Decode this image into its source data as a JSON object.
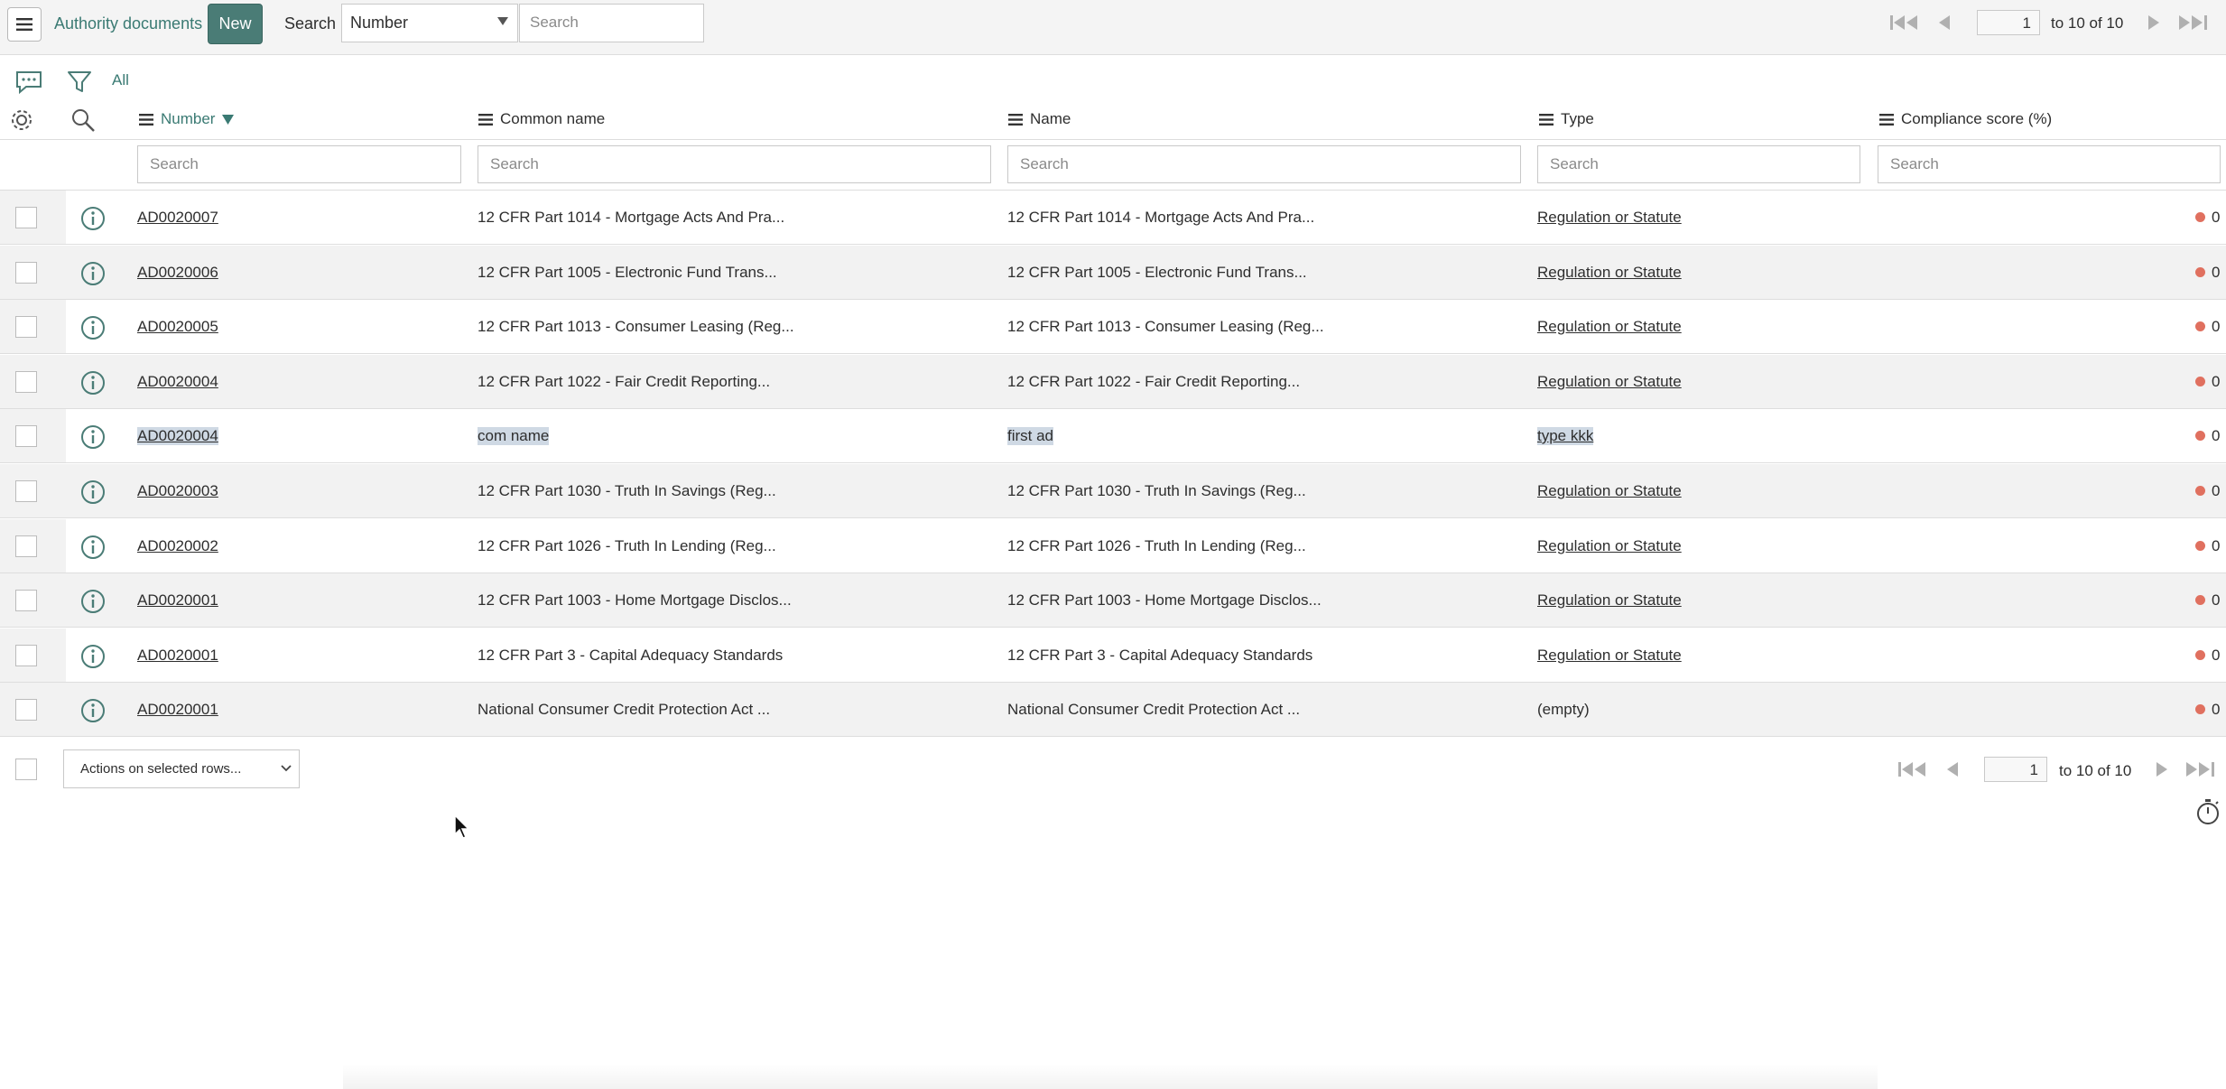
{
  "header": {
    "title": "Authority documents",
    "new_label": "New",
    "search_label": "Search",
    "search_field": "Number",
    "search_placeholder": "Search",
    "page_number": "1",
    "page_range": "to 10 of 10"
  },
  "toolbar": {
    "filter_label": "All"
  },
  "columns": [
    {
      "label": "Number",
      "sorted": "desc"
    },
    {
      "label": "Common name"
    },
    {
      "label": "Name"
    },
    {
      "label": "Type"
    },
    {
      "label": "Compliance score (%)"
    }
  ],
  "column_search_placeholder": "Search",
  "rows": [
    {
      "number": "AD0020007",
      "common_name": "12 CFR Part 1014 - Mortgage Acts And Pra...",
      "name": "12 CFR Part 1014 - Mortgage Acts And Pra...",
      "type": "Regulation or Statute",
      "score": "0"
    },
    {
      "number": "AD0020006",
      "common_name": "12 CFR Part 1005 - Electronic Fund Trans...",
      "name": "12 CFR Part 1005 - Electronic Fund Trans...",
      "type": "Regulation or Statute",
      "score": "0"
    },
    {
      "number": "AD0020005",
      "common_name": "12 CFR Part 1013 - Consumer Leasing (Reg...",
      "name": "12 CFR Part 1013 - Consumer Leasing (Reg...",
      "type": "Regulation or Statute",
      "score": "0"
    },
    {
      "number": "AD0020004",
      "common_name": "12 CFR Part 1022 - Fair Credit Reporting...",
      "name": "12 CFR Part 1022 - Fair Credit Reporting...",
      "type": "Regulation or Statute",
      "score": "0"
    },
    {
      "number": "AD0020004",
      "common_name": "com name",
      "name": "first ad",
      "type": "type kkk",
      "score": "0"
    },
    {
      "number": "AD0020003",
      "common_name": "12 CFR Part 1030 - Truth In Savings (Reg...",
      "name": "12 CFR Part 1030 - Truth In Savings (Reg...",
      "type": "Regulation or Statute",
      "score": "0"
    },
    {
      "number": "AD0020002",
      "common_name": "12 CFR Part 1026 - Truth In Lending (Reg...",
      "name": "12 CFR Part 1026 - Truth In Lending (Reg...",
      "type": "Regulation or Statute",
      "score": "0"
    },
    {
      "number": "AD0020001",
      "common_name": "12 CFR Part 1003 - Home Mortgage Disclos...",
      "name": "12 CFR Part 1003 - Home Mortgage Disclos...",
      "type": "Regulation or Statute",
      "score": "0"
    },
    {
      "number": "AD0020001",
      "common_name": "12 CFR Part 3 - Capital Adequacy Standards",
      "name": "12 CFR Part 3 - Capital Adequacy Standards",
      "type": "Regulation or Statute",
      "score": "0"
    },
    {
      "number": "AD0020001",
      "common_name": "National Consumer Credit Protection Act ...",
      "name": "National Consumer Credit Protection Act ...",
      "type": "(empty)",
      "score": "0"
    }
  ],
  "footer": {
    "actions_label": "Actions on selected rows...",
    "page_number": "1",
    "page_range": "to 10 of 10"
  },
  "colors": {
    "accent": "#4a7c76",
    "link_accent": "#3a7a73",
    "score_dot": "#e0705f",
    "selection_highlight": "#cfd9e4"
  }
}
